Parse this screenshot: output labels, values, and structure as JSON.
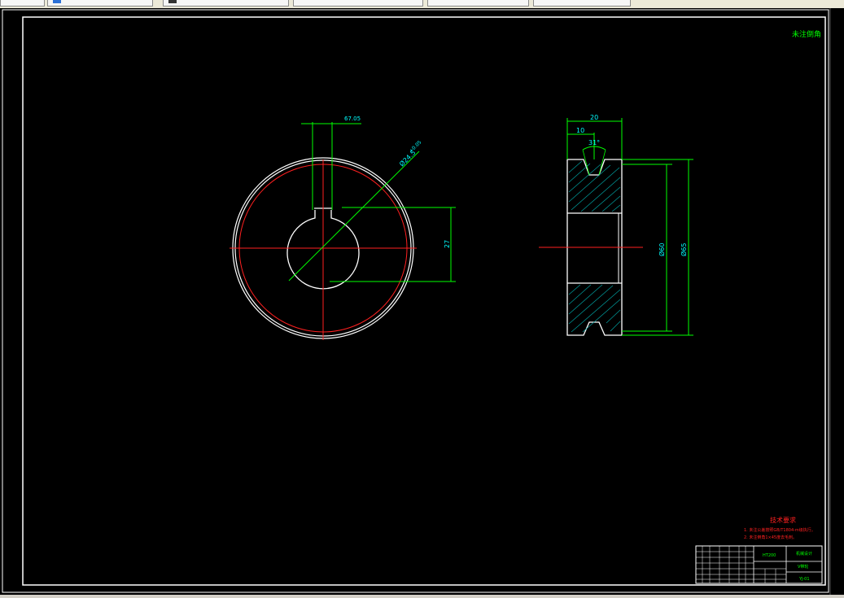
{
  "tabs": [
    {
      "label": ""
    },
    {
      "label": ""
    },
    {
      "label": ""
    },
    {
      "label": ""
    },
    {
      "label": ""
    },
    {
      "label": ""
    }
  ],
  "drawing": {
    "corner_note": "未注倒角",
    "dim_key_offset": "67.05",
    "dim_bore": "Ø24.5",
    "dim_bore_tol": "+0.05",
    "dim_hub": "27",
    "dim_width": "20",
    "dim_groove_center": "10",
    "dim_angle": "31°",
    "dim_d60": "Ø60",
    "dim_d65": "Ø65",
    "tech_title": "技术要求",
    "tech_line1": "1. 未注公差按照GB/T1804-m级执行。",
    "tech_line2": "2. 未注倒角1×45度去毛刺。",
    "tb_material": "HT200",
    "tb_company": "机械设计",
    "tb_part_name": "V带轮",
    "tb_drawing_no": "YJ-01"
  },
  "colors": {
    "background": "#000000",
    "outline": "#ffffff",
    "centerline": "#ff0000",
    "dimension": "#00ff00",
    "dim_text": "#00ffff",
    "hatch": "#00a0a0",
    "note": "#ff2020"
  }
}
